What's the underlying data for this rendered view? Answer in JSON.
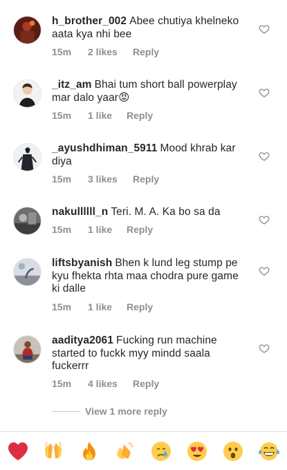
{
  "comments": [
    {
      "username": "h_brother_002",
      "text": "Abee chutiya khelneko aata kya nhi bee",
      "time": "15m",
      "likes": "2 likes",
      "reply": "Reply"
    },
    {
      "username": "_itz_am",
      "text": "Bhai tum short ball powerplay mar dalo yaar😡",
      "time": "15m",
      "likes": "1 like",
      "reply": "Reply"
    },
    {
      "username": "_ayushdhiman_5911",
      "text": "Mood khrab kar diya",
      "time": "15m",
      "likes": "3 likes",
      "reply": "Reply"
    },
    {
      "username": "nakullllll_n",
      "text": "Teri.  M. A. Ka bo sa da",
      "time": "15m",
      "likes": "1 like",
      "reply": "Reply"
    },
    {
      "username": "liftsbyanish",
      "text": "Bhen k lund leg stump pe kyu fhekta rhta maa chodra pure game ki dalle",
      "time": "15m",
      "likes": "1 like",
      "reply": "Reply"
    },
    {
      "username": "aaditya2061",
      "text": "Fucking run machine started to fuckk myy mindd saala fuckerrr",
      "time": "15m",
      "likes": "4 likes",
      "reply": "Reply"
    }
  ],
  "more_replies": "View 1 more reply",
  "emoji_bar": {
    "icons": [
      "red-heart",
      "raising-hands",
      "fire",
      "clapping-hands",
      "crying-face",
      "heart-eyes-face",
      "astonished-face",
      "tears-of-joy-face"
    ]
  },
  "colors": {
    "text": "#262626",
    "secondary": "#8e8e8e",
    "divider": "#dbdbdb"
  }
}
